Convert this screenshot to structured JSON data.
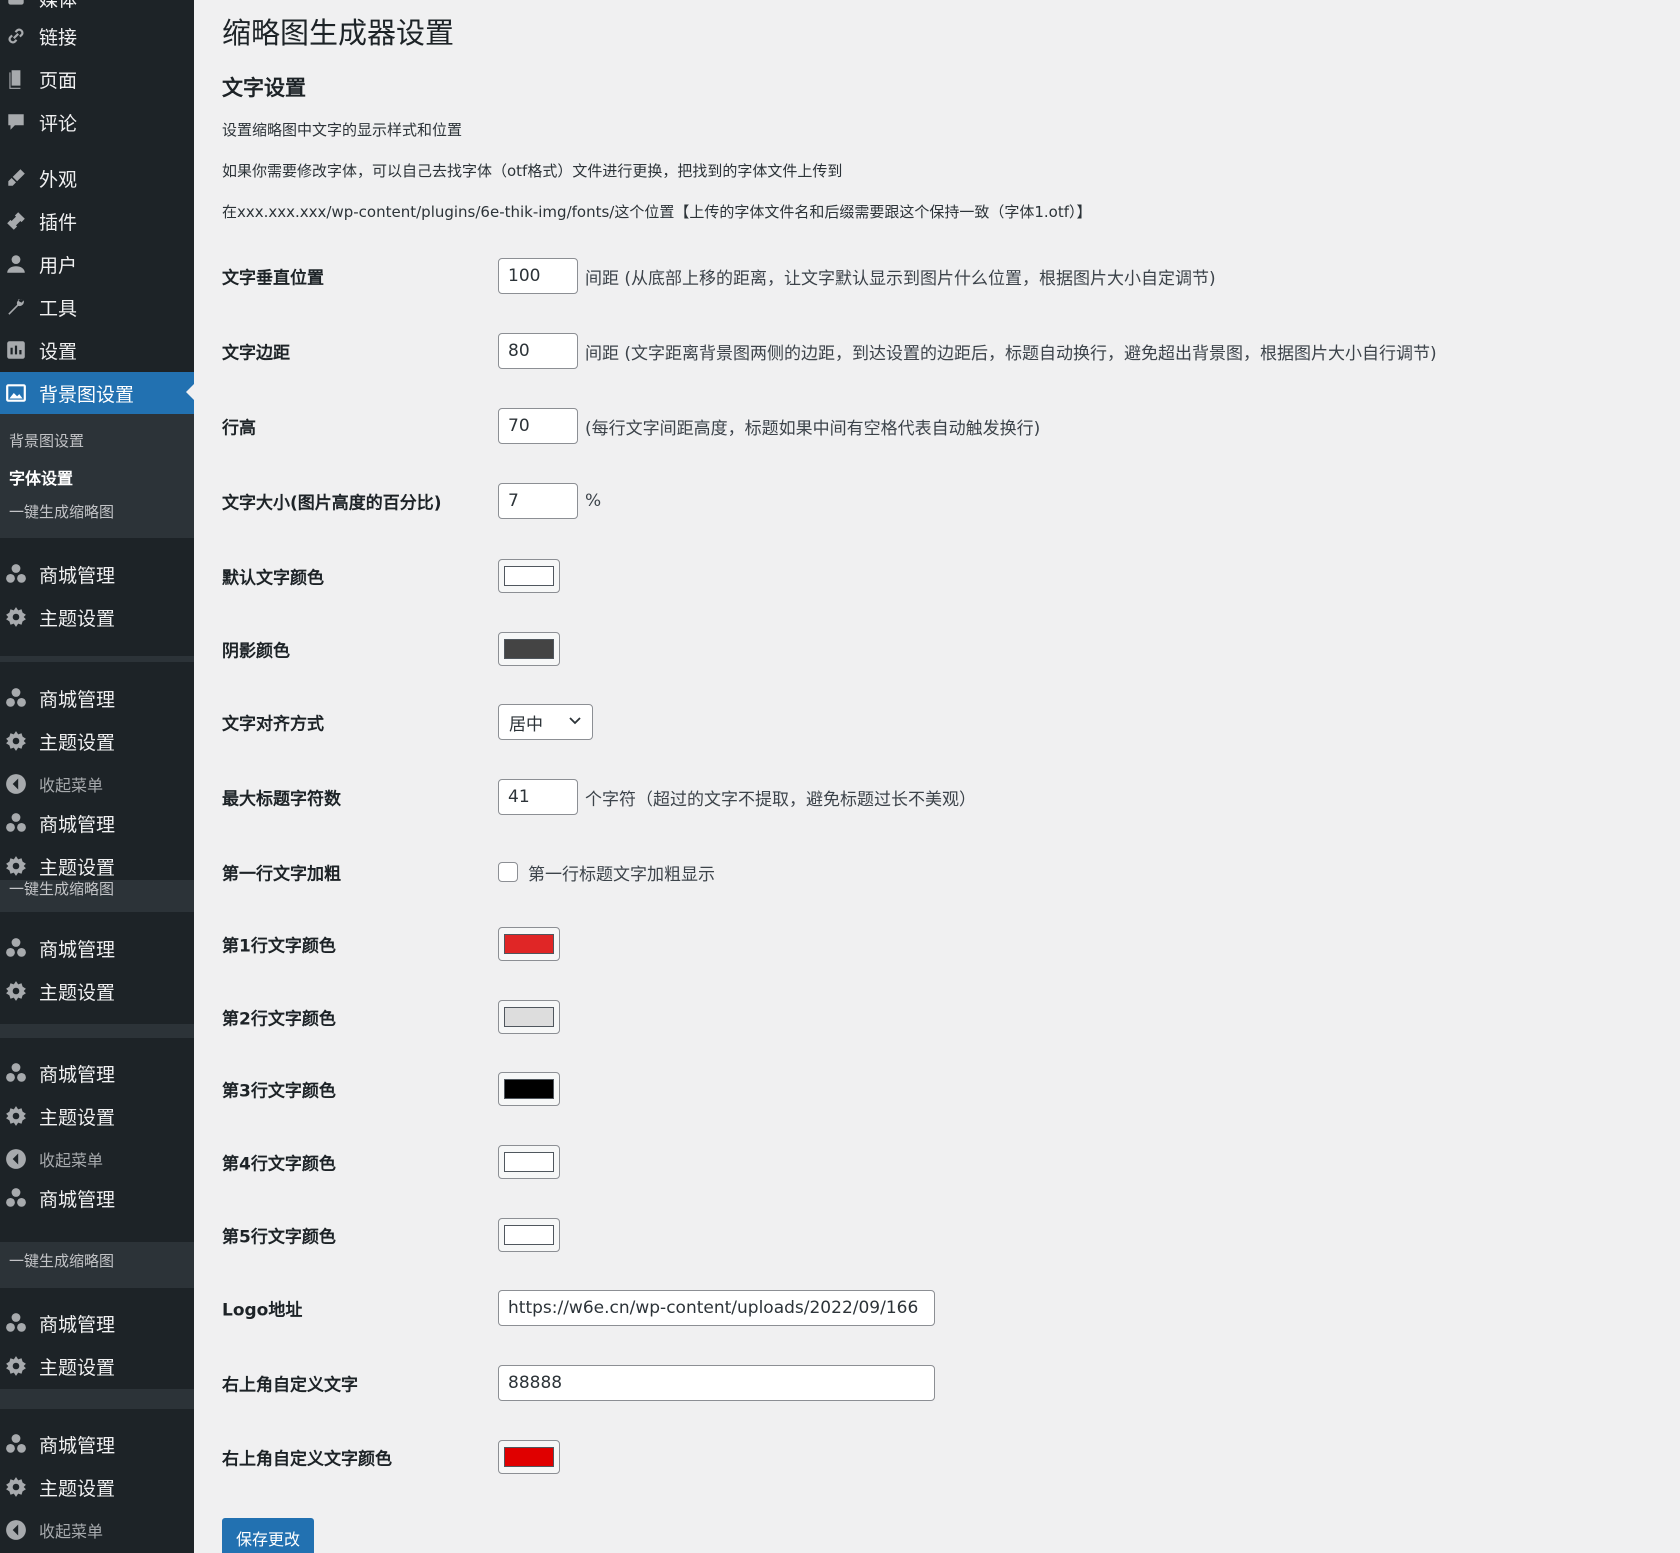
{
  "sidebar": {
    "top_partial": "媒体",
    "items": [
      {
        "label": "链接",
        "icon": "link-icon"
      },
      {
        "label": "页面",
        "icon": "page-icon"
      },
      {
        "label": "评论",
        "icon": "comment-icon"
      },
      {
        "label": "外观",
        "icon": "brush-icon"
      },
      {
        "label": "插件",
        "icon": "plugin-icon"
      },
      {
        "label": "用户",
        "icon": "user-icon"
      },
      {
        "label": "工具",
        "icon": "wrench-icon"
      },
      {
        "label": "设置",
        "icon": "settings-icon"
      },
      {
        "label": "背景图设置",
        "icon": "image-icon"
      }
    ],
    "submenu": [
      "背景图设置",
      "字体设置",
      "一键生成缩略图"
    ],
    "shop": "商城管理",
    "theme": "主题设置",
    "collapse": "收起菜单",
    "gen_thumbnail": "一键生成缩略图"
  },
  "page": {
    "title": "缩略图生成器设置",
    "section_title": "文字设置",
    "desc1": "设置缩略图中文字的显示样式和位置",
    "desc2": "如果你需要修改字体，可以自己去找字体（otf格式）文件进行更换，把找到的字体文件上传到",
    "desc3": "在xxx.xxx.xxx/wp-content/plugins/6e-thik-img/fonts/这个位置【上传的字体文件名和后缀需要跟这个保持一致（字体1.otf）】"
  },
  "fields": {
    "vertical": {
      "label": "文字垂直位置",
      "value": "100",
      "suffix": "间距 (从底部上移的距离，让文字默认显示到图片什么位置，根据图片大小自定调节)"
    },
    "margin": {
      "label": "文字边距",
      "value": "80",
      "suffix": "间距 (文字距离背景图两侧的边距，到达设置的边距后，标题自动换行，避免超出背景图，根据图片大小自行调节)"
    },
    "line_height": {
      "label": "行高",
      "value": "70",
      "suffix": "(每行文字间距高度，标题如果中间有空格代表自动触发换行)"
    },
    "font_size": {
      "label": "文字大小(图片高度的百分比)",
      "value": "7",
      "suffix": "%"
    },
    "default_color": {
      "label": "默认文字颜色",
      "color": "#ffffff"
    },
    "shadow_color": {
      "label": "阴影颜色",
      "color": "#444444"
    },
    "align": {
      "label": "文字对齐方式",
      "value": "居中"
    },
    "max_chars": {
      "label": "最大标题字符数",
      "value": "41",
      "suffix": "个字符（超过的文字不提取，避免标题过长不美观）"
    },
    "bold_first": {
      "label": "第一行文字加粗",
      "checkbox_label": "第一行标题文字加粗显示",
      "checked": false
    },
    "line1_color": {
      "label": "第1行文字颜色",
      "color": "#e02626"
    },
    "line2_color": {
      "label": "第2行文字颜色",
      "color": "#dddddd"
    },
    "line3_color": {
      "label": "第3行文字颜色",
      "color": "#000000"
    },
    "line4_color": {
      "label": "第4行文字颜色",
      "color": "#ffffff"
    },
    "line5_color": {
      "label": "第5行文字颜色",
      "color": "#ffffff"
    },
    "logo": {
      "label": "Logo地址",
      "value": "https://w6e.cn/wp-content/uploads/2022/09/166"
    },
    "corner_text": {
      "label": "右上角自定义文字",
      "value": "88888"
    },
    "corner_color": {
      "label": "右上角自定义文字颜色",
      "color": "#e00000"
    }
  },
  "save_label": "保存更改",
  "colors": {
    "sidebar_bg": "#1d2327",
    "accent": "#2271b1",
    "page_bg": "#f0f0f1"
  }
}
